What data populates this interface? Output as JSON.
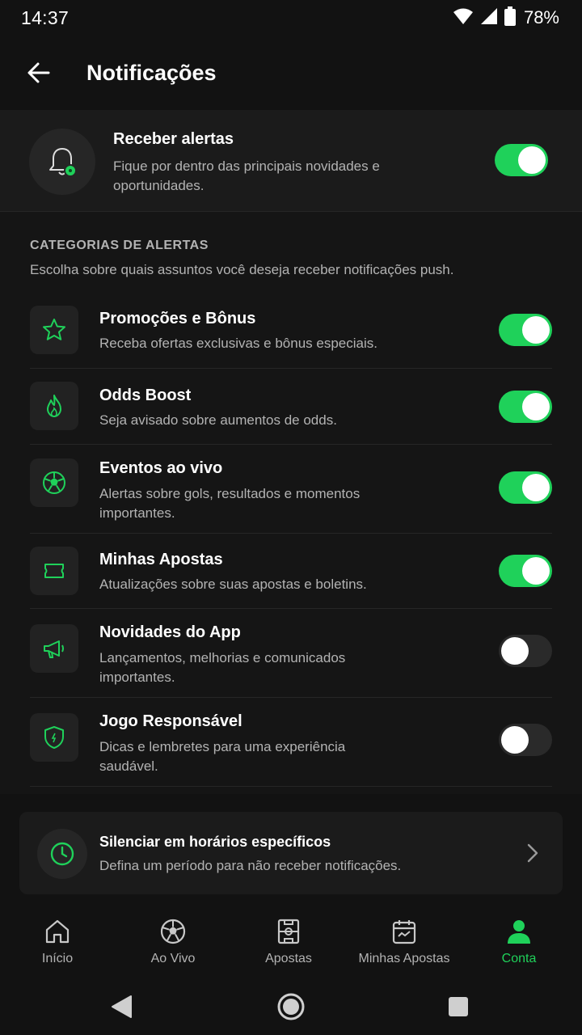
{
  "status_bar": {
    "time": "14:37",
    "battery": "78%"
  },
  "header": {
    "title": "Notificações"
  },
  "master": {
    "title": "Receber alertas",
    "description": "Fique por dentro das principais novidades e oportunidades.",
    "enabled": true,
    "icon": "bell-icon"
  },
  "categories": {
    "title": "CATEGORIAS DE ALERTAS",
    "description": "Escolha sobre quais assuntos você deseja receber notificações push.",
    "items": [
      {
        "title": "Promoções e Bônus",
        "description": "Receba ofertas exclusivas e bônus especiais.",
        "enabled": true,
        "icon": "star-icon"
      },
      {
        "title": "Odds Boost",
        "description": "Seja avisado sobre aumentos de odds.",
        "enabled": true,
        "icon": "flame-icon"
      },
      {
        "title": "Eventos ao vivo",
        "description": "Alertas sobre gols, resultados e momentos importantes.",
        "enabled": true,
        "icon": "soccer-ball-icon"
      },
      {
        "title": "Minhas Apostas",
        "description": "Atualizações sobre suas apostas e boletins.",
        "enabled": true,
        "icon": "ticket-icon"
      },
      {
        "title": "Novidades do App",
        "description": "Lançamentos, melhorias e comunicados importantes.",
        "enabled": false,
        "icon": "megaphone-icon"
      },
      {
        "title": "Jogo Responsável",
        "description": "Dicas e lembretes para uma experiência saudável.",
        "enabled": false,
        "icon": "shield-icon"
      }
    ]
  },
  "mute": {
    "title": "Silenciar em horários específicos",
    "description": "Defina um período para não receber notificações.",
    "icon": "clock-icon"
  },
  "bottom_nav": {
    "items": [
      {
        "label": "Início",
        "icon": "home-icon",
        "active": false
      },
      {
        "label": "Ao Vivo",
        "icon": "soccer-ball-icon",
        "active": false
      },
      {
        "label": "Apostas",
        "icon": "field-icon",
        "active": false
      },
      {
        "label": "Minhas Apostas",
        "icon": "calendar-icon",
        "active": false
      },
      {
        "label": "Conta",
        "icon": "person-icon",
        "active": true
      }
    ]
  },
  "colors": {
    "accent": "#1fd15a",
    "background": "#121212",
    "card": "#1b1b1b",
    "muted_text": "#b3b3b3"
  }
}
